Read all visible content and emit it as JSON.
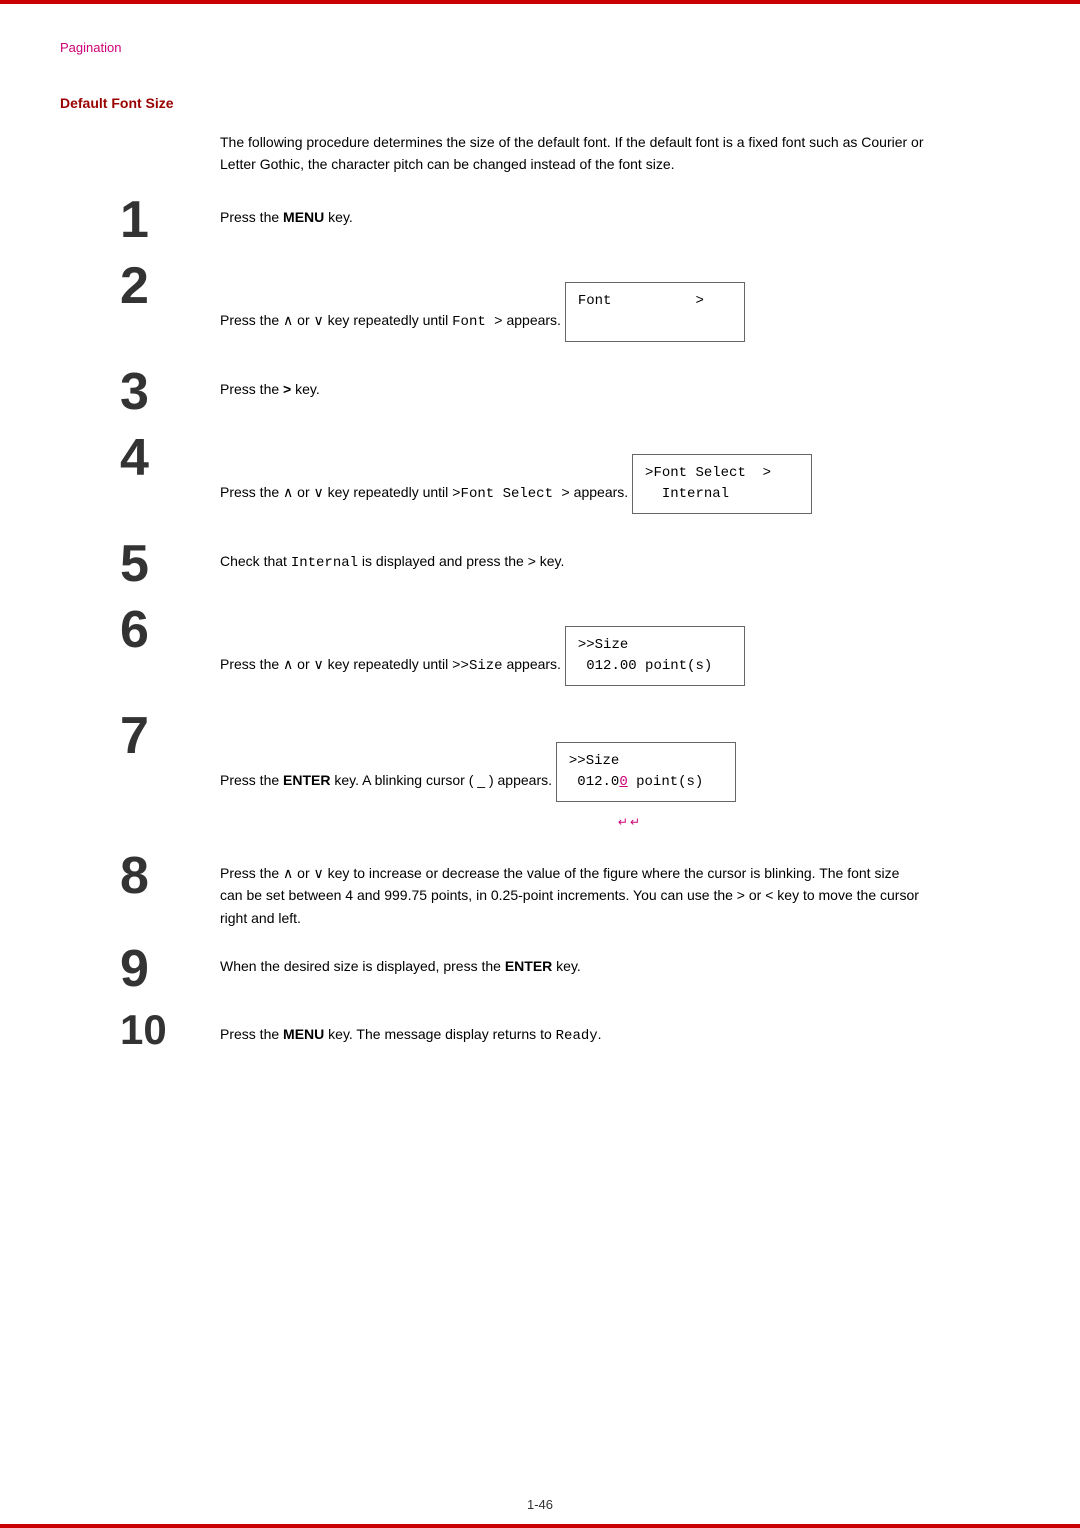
{
  "page": {
    "top_border_color": "#cc0000",
    "bottom_border_color": "#cc0000",
    "breadcrumb": "Pagination",
    "section_heading": "Default Font Size",
    "intro": "The following procedure determines the size of the default font. If the default font is a fixed font such as Courier or Letter Gothic, the character pitch can be changed instead of the font size.",
    "steps": [
      {
        "number": "1",
        "text_before": "Press the ",
        "bold": "MENU",
        "text_after": " key.",
        "has_display": false
      },
      {
        "number": "2",
        "text_before": "Press the ∧ or ∨ key repeatedly until ",
        "inline_code": "Font >",
        "text_after": " appears.",
        "has_display": true,
        "display_lines": [
          "Font          >",
          ""
        ]
      },
      {
        "number": "3",
        "text_before": "Press the ",
        "bold": ">",
        "text_after": " key.",
        "has_display": false
      },
      {
        "number": "4",
        "text_before": "Press the ∧ or ∨ key repeatedly until ",
        "inline_code": ">Font Select >",
        "text_after": " appears.",
        "has_display": true,
        "display_lines": [
          ">Font Select  >",
          "  Internal"
        ]
      },
      {
        "number": "5",
        "text_before": "Check that ",
        "inline_code": "Internal",
        "text_after": " is displayed and press the > key.",
        "has_display": false
      },
      {
        "number": "6",
        "text_before": "Press the ∧ or ∨ key repeatedly until ",
        "inline_code": ">>Size",
        "text_after": " appears.",
        "has_display": true,
        "display_lines": [
          ">>Size",
          " 012.00 point(s)"
        ]
      },
      {
        "number": "7",
        "text_before": "Press the ",
        "bold": "ENTER",
        "text_after": " key. A blinking cursor ( _ ) appears.",
        "has_display": true,
        "display_lines": [
          ">>Size",
          " 012.00 point(s)"
        ],
        "has_cursor": true
      },
      {
        "number": "8",
        "text_before": "Press the ∧ or ∨ key to increase or decrease the value of the figure where the cursor is blinking. The font size can be set between 4 and 999.75 points, in 0.25-point increments. You can use the > or < key to move the cursor right and left.",
        "has_display": false
      },
      {
        "number": "9",
        "text_before": "When the desired size is displayed, press the ",
        "bold": "ENTER",
        "text_after": " key.",
        "has_display": false
      },
      {
        "number": "10",
        "text_before": "Press the ",
        "bold": "MENU",
        "text_after": " key. The message display returns to ",
        "inline_code_after": "Ready",
        "text_end": ".",
        "has_display": false
      }
    ],
    "footer": "1-46"
  }
}
